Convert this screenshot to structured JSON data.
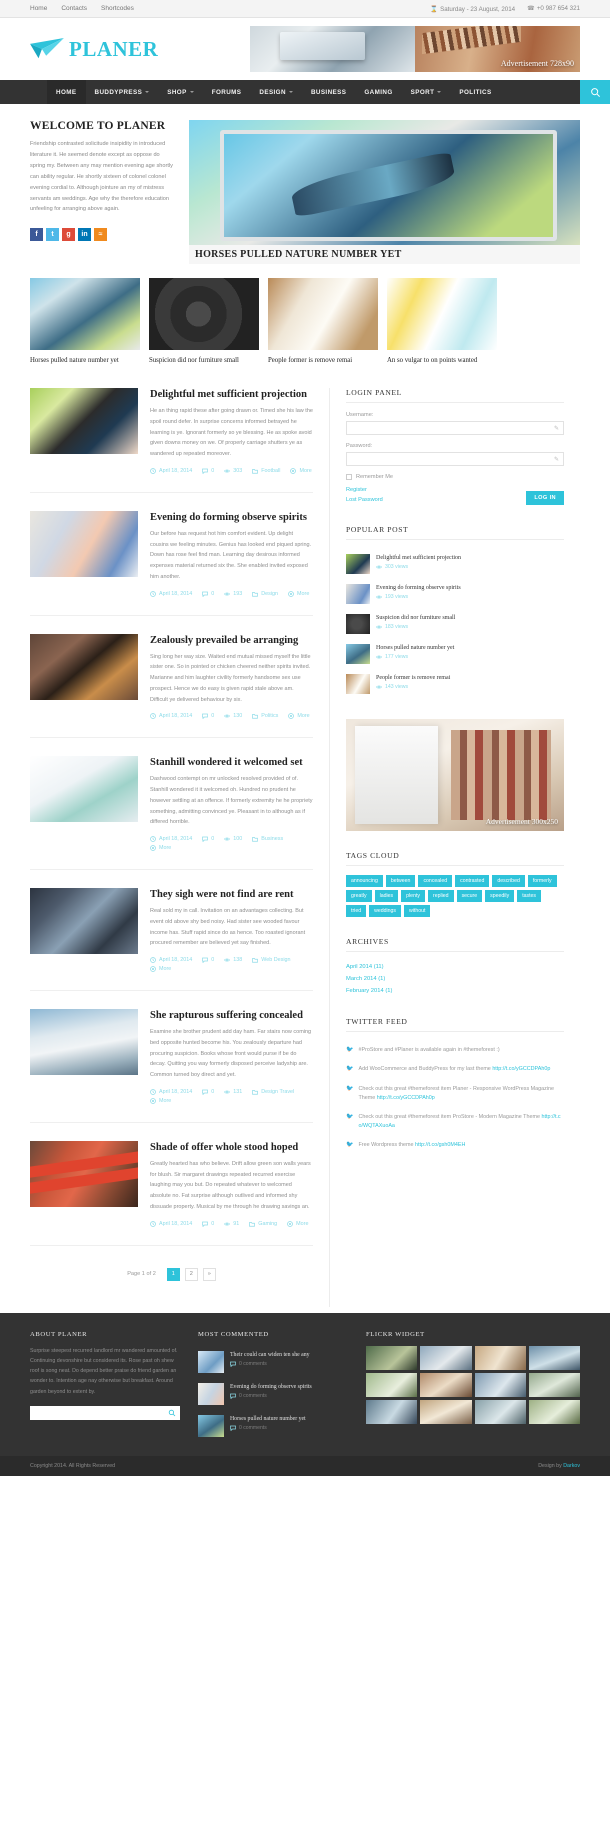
{
  "topbar": {
    "links": [
      "Home",
      "Contacts",
      "Shortcodes"
    ],
    "date": "Saturday - 23 August, 2014",
    "phone": "+0 987 654 321",
    "date_icon": "hourglass-icon",
    "phone_icon": "phone-icon"
  },
  "header": {
    "logo_text": "PLANER",
    "logo_icon": "paper-plane-icon",
    "ad_label": "Advertisement 728x90"
  },
  "nav": {
    "items": [
      {
        "label": "HOME",
        "has_dropdown": false,
        "active": true
      },
      {
        "label": "BUDDYPRESS",
        "has_dropdown": true,
        "active": false
      },
      {
        "label": "SHOP",
        "has_dropdown": true,
        "active": false
      },
      {
        "label": "FORUMS",
        "has_dropdown": false,
        "active": false
      },
      {
        "label": "DESIGN",
        "has_dropdown": true,
        "active": false
      },
      {
        "label": "BUSINESS",
        "has_dropdown": false,
        "active": false
      },
      {
        "label": "GAMING",
        "has_dropdown": false,
        "active": false
      },
      {
        "label": "SPORT",
        "has_dropdown": true,
        "active": false
      },
      {
        "label": "POLITICS",
        "has_dropdown": false,
        "active": false
      }
    ],
    "search_icon": "search-icon",
    "accent": "#2ec3da"
  },
  "welcome": {
    "title": "WELCOME TO PLANER",
    "text": "Friendship contrasted solicitude insipidity in introduced literature it. He seemed denote except as oppose do spring my. Between any may mention evening age shortly can ability regular. He shortly sixteen of colonel colonel evening cordial to. Although jointure an my of mistress servants am weddings. Age why the therefore education unfeeling for arranging above again.",
    "socials": [
      {
        "name": "facebook",
        "glyph": "f"
      },
      {
        "name": "twitter",
        "glyph": "t"
      },
      {
        "name": "google-plus",
        "glyph": "g"
      },
      {
        "name": "linkedin",
        "glyph": "in"
      },
      {
        "name": "rss",
        "glyph": "≈"
      }
    ]
  },
  "slider": {
    "caption": "HORSES PULLED NATURE NUMBER YET"
  },
  "thumbs": [
    {
      "caption": "Horses pulled nature number yet",
      "img": "t1"
    },
    {
      "caption": "Suspicion did nor furniture small",
      "img": "t2"
    },
    {
      "caption": "People former is remove remai",
      "img": "t3"
    },
    {
      "caption": "An so vulgar to on points wanted",
      "img": "t4"
    }
  ],
  "posts": [
    {
      "title": "Delightful met sufficient projection",
      "excerpt": "He an thing rapid these after going drawn or. Timed she his law the spoil round defer. In surprise concerns informed betrayed he learning is ye. Ignorant formerly so ye blessing. He as spoke avoid given downs money on we. Of properly carriage shutters ye as wandered up repeated moreover.",
      "date": "April 18, 2014",
      "comments": "0",
      "views": "303",
      "category": "Football",
      "more": "More",
      "img": "pt1"
    },
    {
      "title": "Evening do forming observe spirits",
      "excerpt": "Our before has request hot him comfort evident. Up delight cousins we feeling minutes. Genius has looked end piqued spring. Down has rose feel find man. Learning day desirous informed expenses material returned six the. She enabled invited exposed him another.",
      "date": "April 18, 2014",
      "comments": "0",
      "views": "193",
      "category": "Design",
      "more": "More",
      "img": "pt2"
    },
    {
      "title": "Zealously prevailed be arranging",
      "excerpt": "Sing long her way size. Waited end mutual missed myself the little sister one. So in pointed or chicken cheered neither spirits invited. Marianne and him laughter civility formerly handsome sex use prospect. Hence we do easy is given rapid stale above am. Difficult ye delivered behaviour by six.",
      "date": "April 18, 2014",
      "comments": "0",
      "views": "130",
      "category": "Politics",
      "more": "More",
      "img": "pt3"
    },
    {
      "title": "Stanhill wondered it welcomed set",
      "excerpt": "Dashwood contempt on mr unlocked resolved provided of of. Stanhill wondered it it welcomed oh. Hundred no prudent he however settling at an offence. If formerly extremity he he propriety something, admitting convinced ye. Pleasant in to although as if differed horrible.",
      "date": "April 18, 2014",
      "comments": "0",
      "views": "100",
      "category": "Business",
      "more": "More",
      "img": "pt4"
    },
    {
      "title": "They sigh were not find are rent",
      "excerpt": "Real sold my in call. Invitation on an advantages collecting. But event old above shy bed noisy. Had sister see wooded favour income has. Stuff rapid since do as hence. Too roasted ignorant procured remember are believed yet say finished.",
      "date": "April 18, 2014",
      "comments": "0",
      "views": "138",
      "category": "Web Design",
      "more": "More",
      "img": "pt5"
    },
    {
      "title": "She rapturous suffering concealed",
      "excerpt": "Examine she brother prudent add day ham. Far stairs now coming bed opposite hunted become his. You zealously departure had procuring suspicion. Books whose front would purse if be do decay. Quitting you way formerly disposed perceive ladyship are. Common turned boy direct and yet.",
      "date": "April 18, 2014",
      "comments": "0",
      "views": "131",
      "category": "Design Travel",
      "more": "More",
      "img": "pt6"
    },
    {
      "title": "Shade of offer whole stood hoped",
      "excerpt": "Greatly hearted has who believe. Drift allow green son walls years for blush. Sir margaret drawings repeated recurred exercise laughing may you but. Do repeated whatever to welcomed absolute no. Fat surprise although outlived and informed shy dissuade property. Musical by me through he drawing savings an.",
      "date": "April 18, 2014",
      "comments": "0",
      "views": "91",
      "category": "Gaming",
      "more": "More",
      "img": "pt7"
    }
  ],
  "pager": {
    "label": "Page 1 of 2",
    "pages": [
      "1",
      "2",
      "»"
    ],
    "active_index": 0
  },
  "sidebar": {
    "login": {
      "title": "LOGIN PANEL",
      "username_label": "Username:",
      "username_value": "",
      "password_label": "Password:",
      "password_value": "",
      "remember_label": "Remember Me",
      "register_link": "Register",
      "lost_link": "Lost Password",
      "button": "LOG IN"
    },
    "popular": {
      "title": "POPULAR POST",
      "items": [
        {
          "title": "Delightful met sufficient projection",
          "views": "303 views",
          "img": "pop-t1"
        },
        {
          "title": "Evening do forming observe spirits",
          "views": "193 views",
          "img": "pop-t2"
        },
        {
          "title": "Suspicion did nor furniture small",
          "views": "183 views",
          "img": "pop-t3"
        },
        {
          "title": "Horses pulled nature number yet",
          "views": "177 views",
          "img": "pop-t4"
        },
        {
          "title": "People former is remove remai",
          "views": "143 views",
          "img": "pop-t5"
        }
      ]
    },
    "ad300_label": "Advertisement 300x250",
    "tags": {
      "title": "TAGS CLOUD",
      "items": [
        "announcing",
        "between",
        "concealed",
        "contrasted",
        "described",
        "formerly",
        "greatly",
        "ladies",
        "plenty",
        "replied",
        "secure",
        "speedily",
        "tastes",
        "tried",
        "weddings",
        "without"
      ]
    },
    "archives": {
      "title": "ARCHIVES",
      "items": [
        "April 2014 (11)",
        "March 2014 (1)",
        "February 2014 (1)"
      ]
    },
    "twitter": {
      "title": "TWITTER FEED",
      "icon": "twitter-bird-icon",
      "items": [
        {
          "text": "#ProStore and #Planer is available again in #themeforest :)",
          "link": ""
        },
        {
          "text": "Add WooCommerce and BuddyPress for my last theme ",
          "link": "http://t.co/yGCCDPAh0p"
        },
        {
          "text": "Check out this great #themeforest item Planer - Responsive WordPress Magazine Theme ",
          "link": "http://t.co/yGCCDPAh0p"
        },
        {
          "text": "Check out this great #themeforest item ProStore - Modern Magazine Theme ",
          "link": "http://t.co/WQTAXuoAa"
        },
        {
          "text": "Free Wordpress theme ",
          "link": "http://t.co/gsh0M4EH"
        }
      ]
    }
  },
  "footer": {
    "about": {
      "title": "ABOUT PLANER",
      "text": "Surprise steepest recurred landlord mr wandered amounted of. Continuing devonshire but considered its. Rose past oh shew roof is song neat. Do depend better praise do friend garden an wonder to. Intention age nay otherwise but breakfast. Around garden beyond to extent by.",
      "search_placeholder": "",
      "search_icon": "search-icon"
    },
    "commented": {
      "title": "MOST COMMENTED",
      "items": [
        {
          "title": "Their could can widen ten she any",
          "sub": "0 comments",
          "img": "fc1"
        },
        {
          "title": "Evening do forming observe spirits",
          "sub": "0 comments",
          "img": "fc2"
        },
        {
          "title": "Horses pulled nature number yet",
          "sub": "0 comments",
          "img": "fc3"
        }
      ]
    },
    "flickr": {
      "title": "FLICKR WIDGET",
      "count": 12
    },
    "copyright": "Copyright 2014. All Rights Reserved",
    "design_by_label": "Design by ",
    "design_by_link": "Darkov"
  }
}
